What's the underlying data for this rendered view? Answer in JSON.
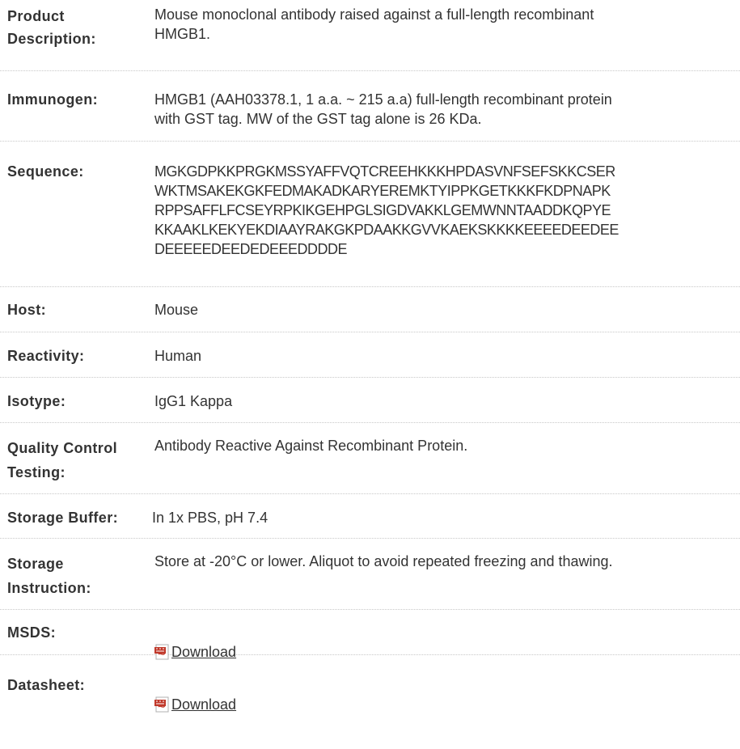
{
  "rows": [
    {
      "label": "Product\nDescription:",
      "value": "Mouse monoclonal antibody raised against a full-length recombinant\nHMGB1."
    },
    {
      "label": "Immunogen:",
      "value": "HMGB1 (AAH03378.1, 1 a.a. ~ 215 a.a) full-length recombinant protein\nwith GST tag. MW of the GST tag alone is 26 KDa."
    },
    {
      "label": "Sequence:",
      "value": "MGKGDPKKPRGKMSSYAFFVQTCREEHKKKHPDASVNFSEFSKKCSER\nWKTMSAKEKGKFEDMAKADKARYEREMKTYIPPKGETKKKFKDPNAPK\nRPPSAFFLFCSEYRPKIKGEHPGLSIGDVAKKLGEMWNNTAADDKQPYE\nKKAAKLKEKYEKDIAAYRAKGKPDAAKKGVVKAEKSKKKKEEEEDEEDEE\nDEEEEEDEEDEDEEEDDDDE"
    },
    {
      "label": "Host:",
      "value": "Mouse"
    },
    {
      "label": "Reactivity:",
      "value": "Human"
    },
    {
      "label": "Isotype:",
      "value": "IgG1 Kappa"
    },
    {
      "label": "Quality Control\nTesting:",
      "value": "Antibody Reactive Against Recombinant Protein."
    },
    {
      "label": "Storage Buffer:",
      "value": "In 1x PBS, pH 7.4"
    },
    {
      "label": "Storage\nInstruction:",
      "value": "Store at -20°C or lower. Aliquot to avoid repeated freezing and thawing."
    },
    {
      "label": "MSDS:",
      "link_text": "Download",
      "icon": "pdf-icon"
    },
    {
      "label": "Datasheet:",
      "link_text": "Download",
      "icon": "pdf-icon"
    }
  ],
  "colors": {
    "text": "#333333",
    "divider": "#c8c8c8",
    "pdf_icon": "#c0392b"
  }
}
